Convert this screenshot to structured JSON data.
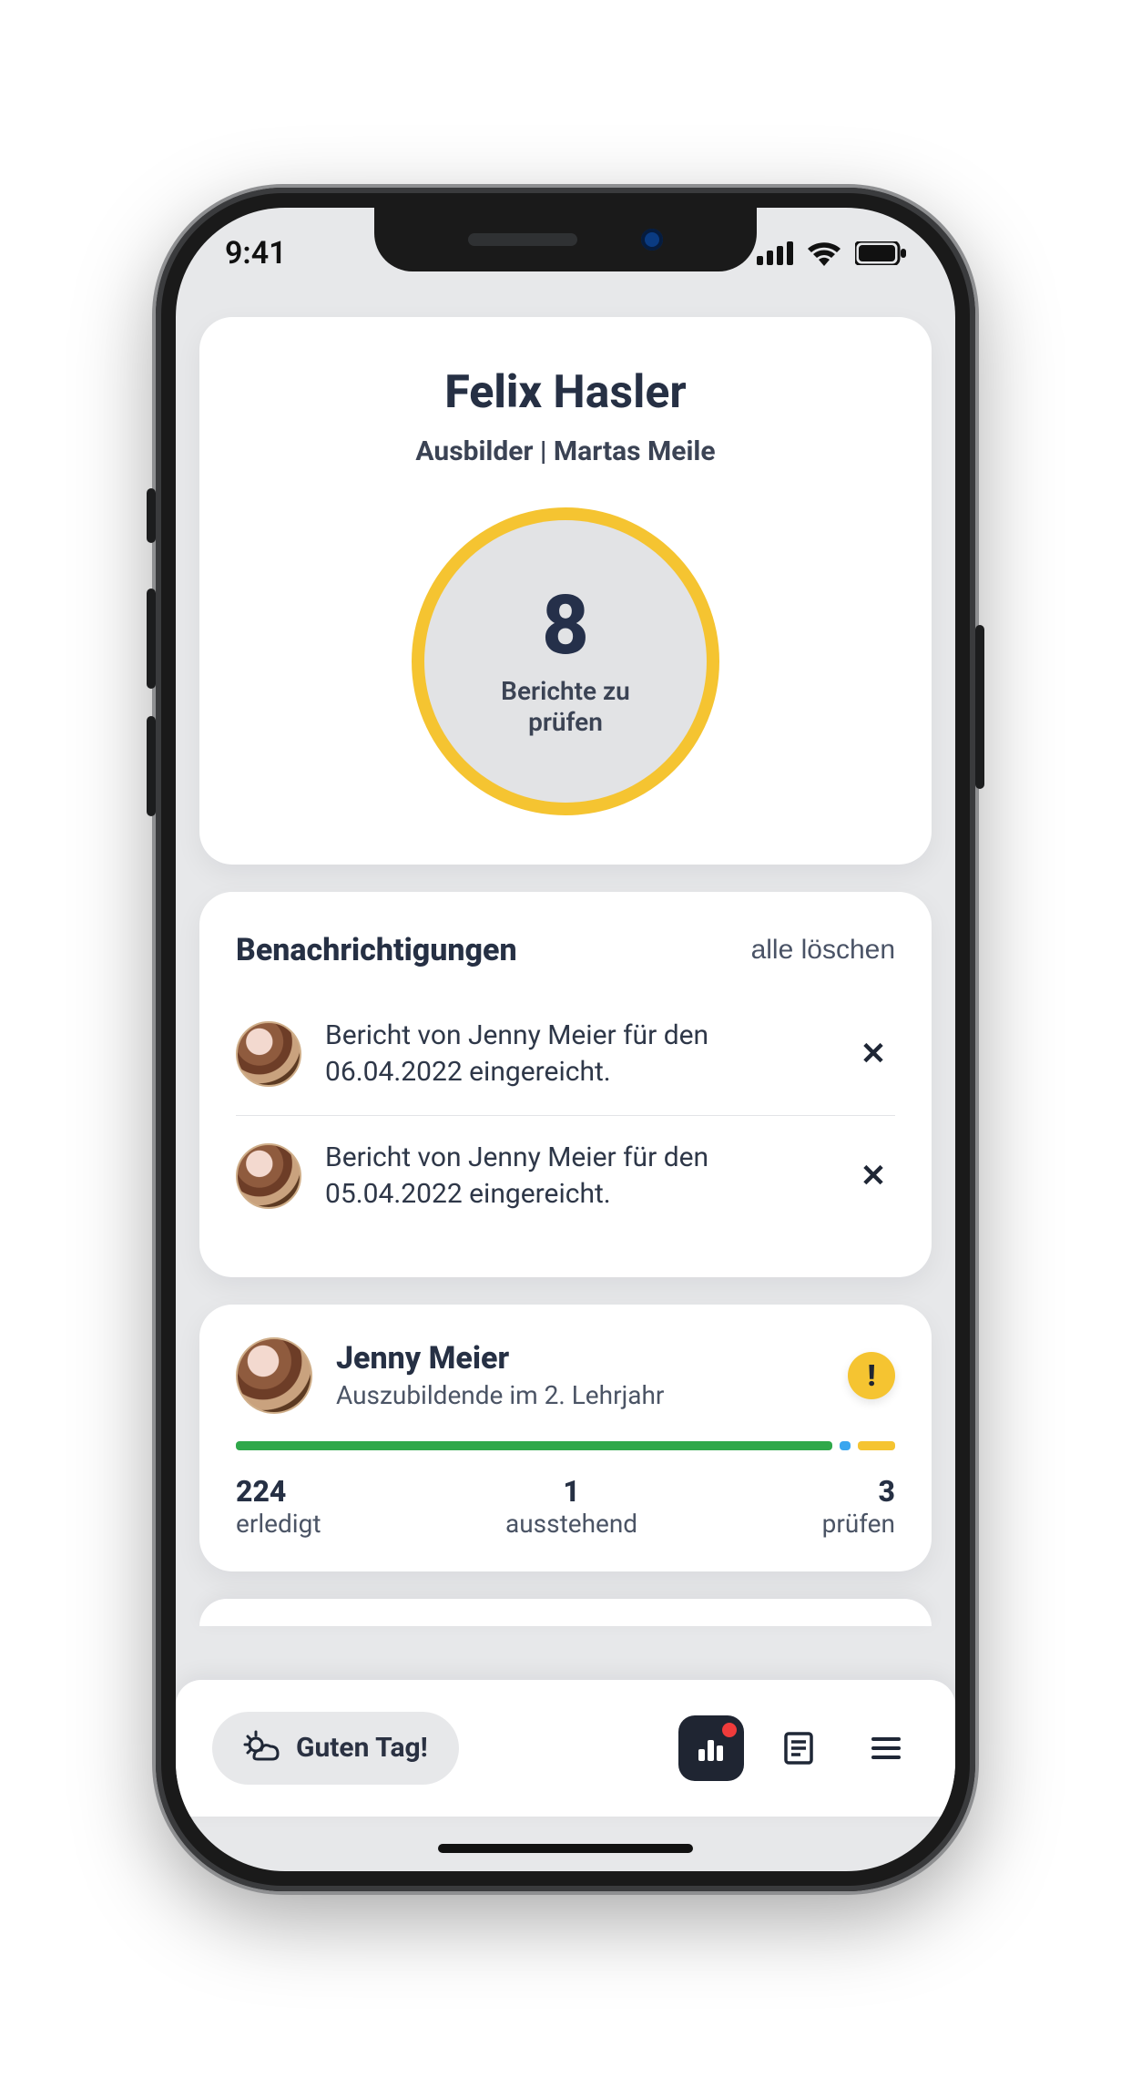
{
  "status_bar": {
    "time": "9:41"
  },
  "user": {
    "first_name": "Felix",
    "last_name": "Hasler",
    "role_line": "Ausbilder | Martas Meile"
  },
  "ring": {
    "count": "8",
    "label": "Berichte zu prüfen"
  },
  "notifications": {
    "title": "Benachrichtigungen",
    "clear_all": "alle löschen",
    "items": [
      {
        "text": "Bericht von Jenny Meier für den 06.04.2022 eingereicht."
      },
      {
        "text": "Bericht von Jenny Meier für den 05.04.2022 eingereicht."
      }
    ]
  },
  "trainee": {
    "name": "Jenny Meier",
    "subtitle": "Auszubildende im 2. Lehrjahr",
    "stats": {
      "done": {
        "value": "224",
        "label": "erledigt"
      },
      "pending": {
        "value": "1",
        "label": "ausstehend"
      },
      "review": {
        "value": "3",
        "label": "prüfen"
      }
    }
  },
  "bottom_bar": {
    "greeting": "Guten Tag!"
  },
  "colors": {
    "accent_yellow": "#f5c431",
    "green": "#2fa84a",
    "blue": "#3aa6ef",
    "surface": "#ffffff",
    "page_bg": "#e7e8ea",
    "text": "#263044"
  }
}
